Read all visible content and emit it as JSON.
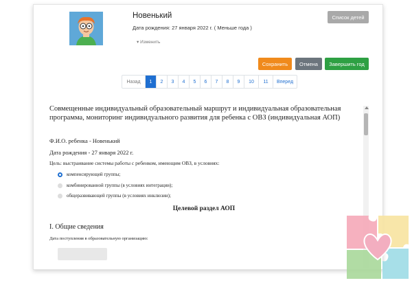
{
  "profile": {
    "name": "Новенький",
    "dob_line": "Дата рождения: 27 января 2022 г. ( Меньше года )",
    "edit_link": "Изменить"
  },
  "toolbar": {
    "children_list": "Список детей",
    "save": "Сохранить",
    "cancel": "Отмена",
    "finish_year": "Завершить год"
  },
  "pagination": {
    "prev": "Назад",
    "pages": [
      "1",
      "2",
      "3",
      "4",
      "5",
      "6",
      "7",
      "8",
      "9",
      "10",
      "11"
    ],
    "active": "1",
    "next": "Вперед"
  },
  "document": {
    "title": "Совмещенные индивидуальный образовательный маршрут и индивидуальная образовательная программа, мониторинг индивидуального развития для ребенка с ОВЗ (индивидуальная АОП)",
    "fio": "Ф.И.О. ребенка - Новенький",
    "birth": "Дата рождения - 27 января 2022 г.",
    "goal": "Цель: выстраивание системы работы с ребенком, имеющим ОВЗ, в условиях:",
    "options": [
      {
        "label": "компенсирующей группы;",
        "selected": true
      },
      {
        "label": "комбинированной группы (в условиях интеграции);",
        "selected": false
      },
      {
        "label": "общеразвивающей группы (в условиях инклюзии);",
        "selected": false
      }
    ],
    "section_heading": "Целевой раздел АОП",
    "general_heading": "I. Общие сведения",
    "admission_label": "Дата поступления в образовательную организацию:"
  },
  "colors": {
    "accent_blue": "#1f6fd1",
    "save_orange": "#f08a1c",
    "cancel_gray": "#6c757d",
    "finish_green": "#2ea043"
  }
}
